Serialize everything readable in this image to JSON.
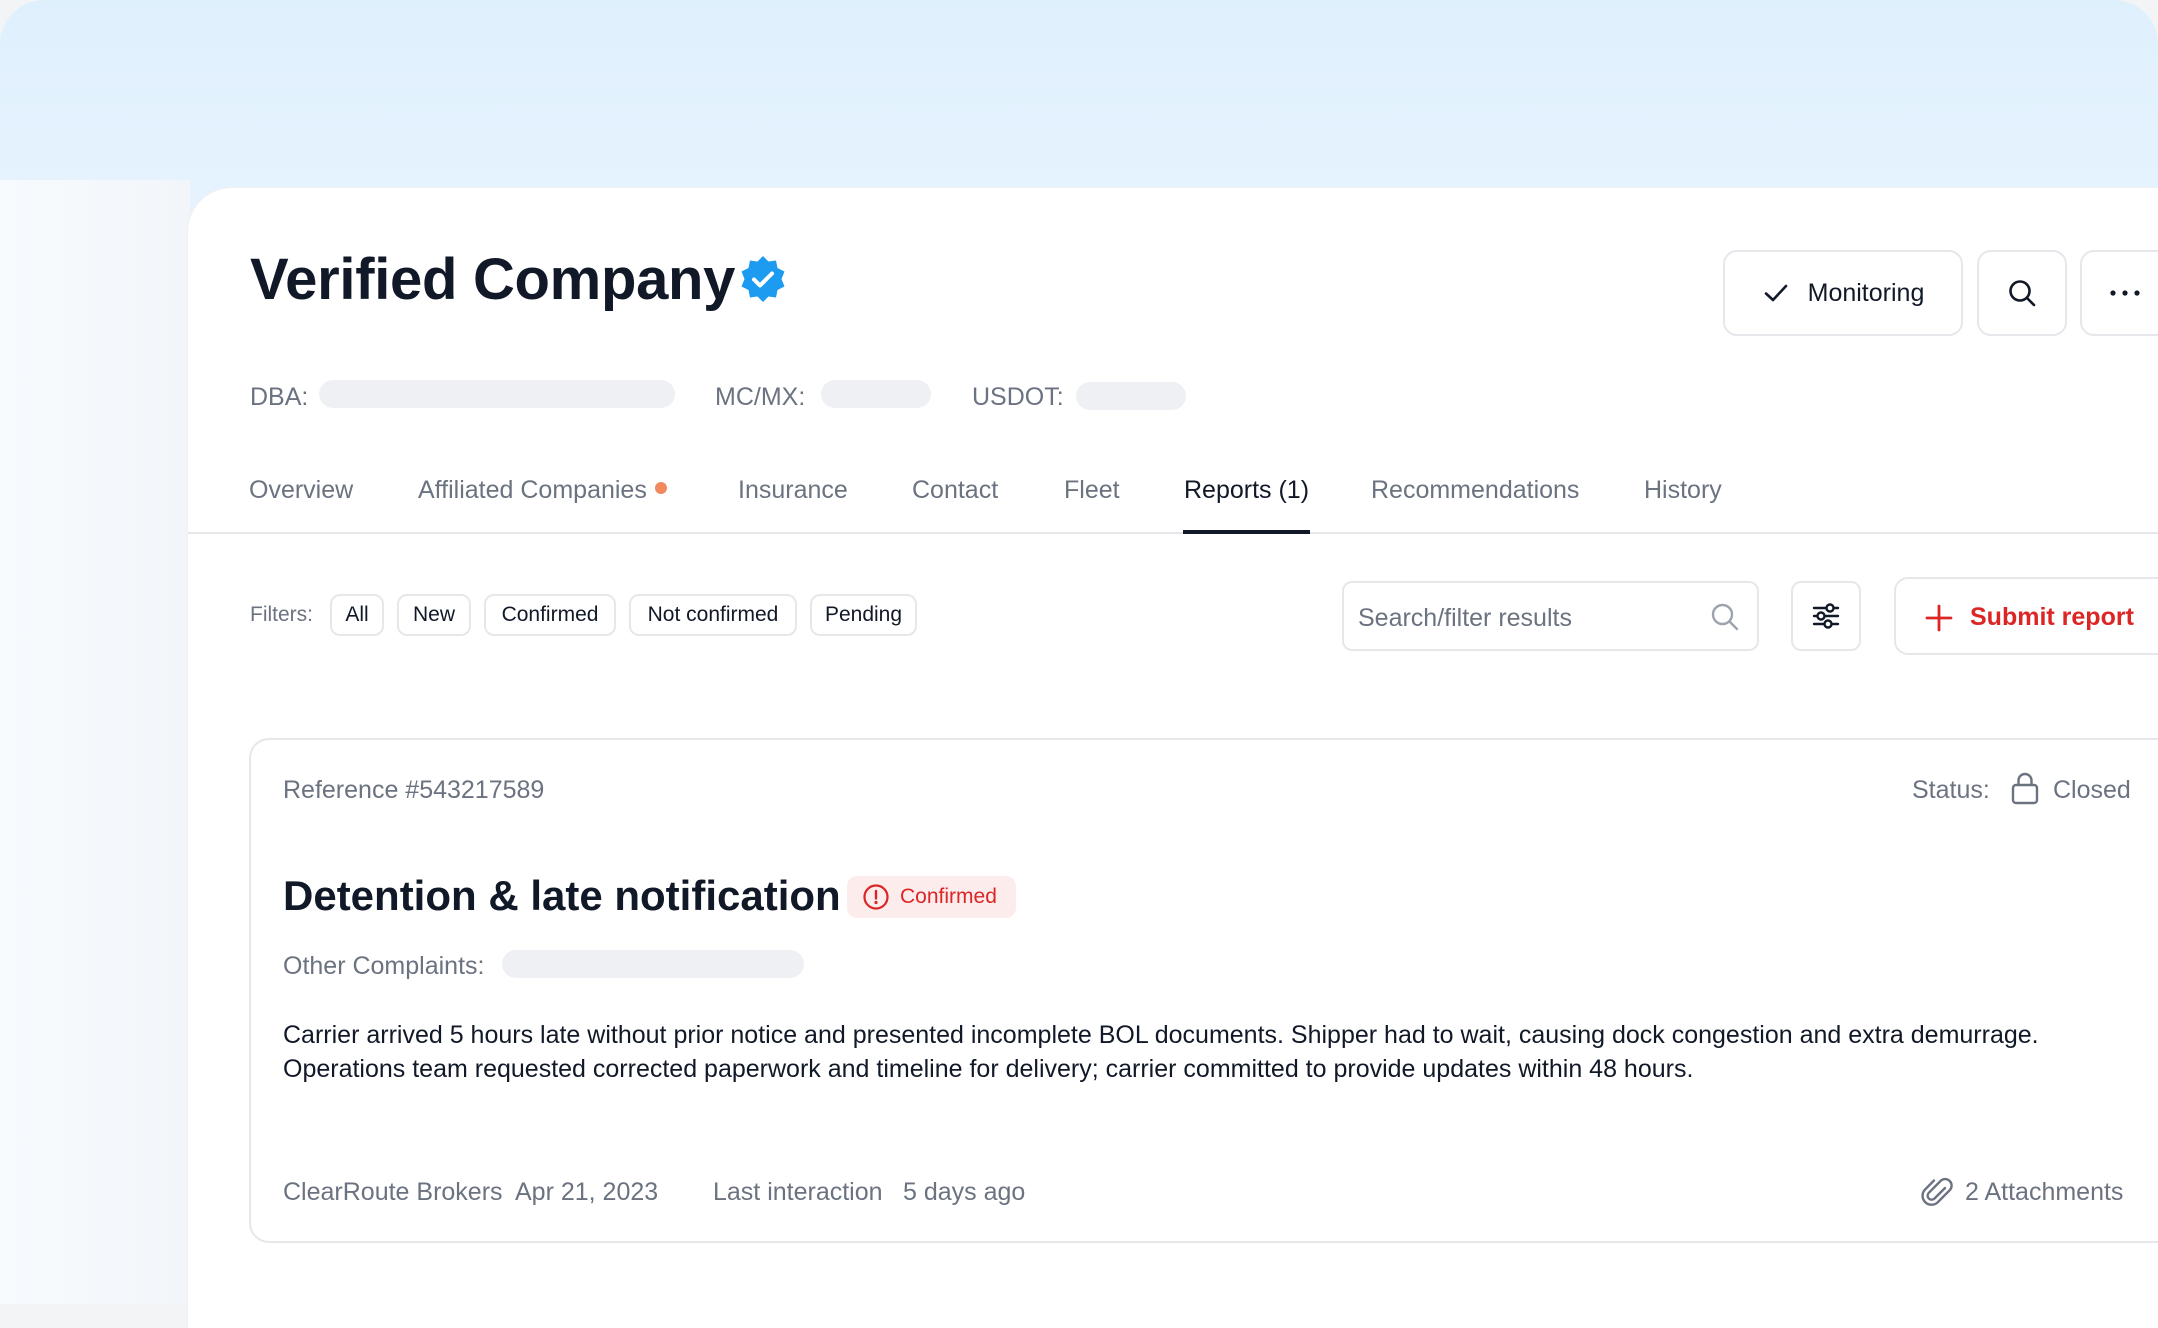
{
  "header": {
    "title": "Verified Company",
    "meta": [
      {
        "label": "DBA:"
      },
      {
        "label": "MC/MX:"
      },
      {
        "label": "USDOT:"
      }
    ],
    "monitoring_label": "Monitoring"
  },
  "tabs": [
    {
      "label": "Overview",
      "active": false
    },
    {
      "label": "Affiliated Companies",
      "active": false,
      "has_dot": true
    },
    {
      "label": "Insurance",
      "active": false
    },
    {
      "label": "Contact",
      "active": false
    },
    {
      "label": "Fleet",
      "active": false
    },
    {
      "label": "Reports (1)",
      "active": true
    },
    {
      "label": "Recommendations",
      "active": false
    },
    {
      "label": "History",
      "active": false
    }
  ],
  "filters": {
    "label": "Filters:",
    "chips": [
      "All",
      "New",
      "Confirmed",
      "Not confirmed",
      "Pending"
    ],
    "search_placeholder": "Search/filter results",
    "submit_label": "Submit report"
  },
  "report": {
    "reference": "Reference #543217589",
    "status_label": "Status:",
    "status_value": "Closed",
    "title": "Detention & late notification",
    "badge": "Confirmed",
    "other_label": "Other Complaints:",
    "body_line1": "Carrier arrived 5 hours late without prior notice and presented incomplete BOL documents. Shipper had to wait, causing dock congestion and extra demurrage.",
    "body_line2": "Operations team requested corrected paperwork and timeline for delivery; carrier committed to provide updates within 48 hours.",
    "company": "ClearRoute Brokers",
    "date": "Apr 21, 2023",
    "last_interaction_label": "Last interaction",
    "last_interaction_value": "5 days ago",
    "attachments": "2 Attachments"
  },
  "colors": {
    "accent_blue": "#1d9bf0",
    "danger_red": "#dc2626",
    "tab_dot": "#f08a5d"
  }
}
